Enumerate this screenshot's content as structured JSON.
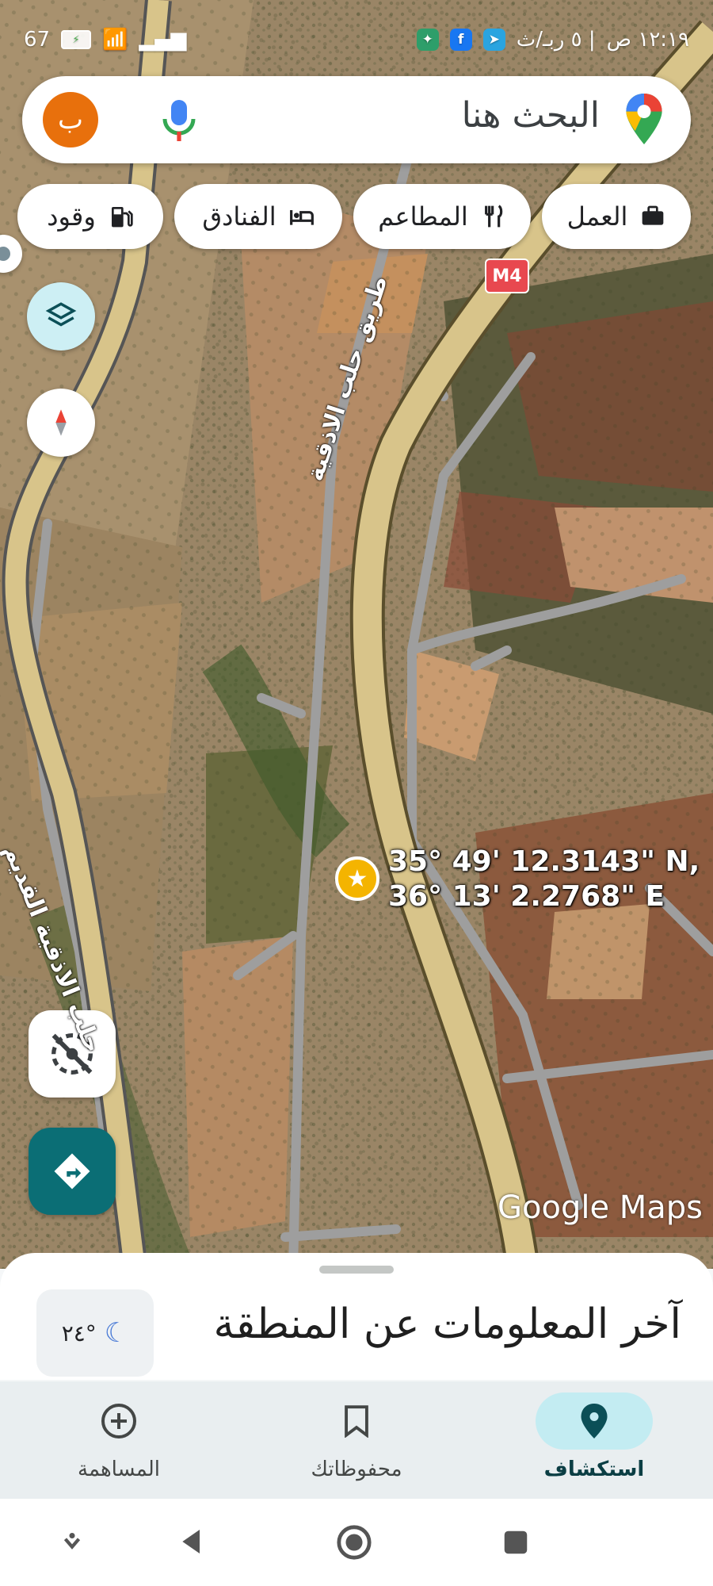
{
  "status_bar": {
    "battery_level": "67",
    "time": "١٢:١٩ ص",
    "date": "| ٥ ربـ/ث"
  },
  "search": {
    "placeholder": "البحث هنا",
    "avatar_letter": "ب"
  },
  "chips": [
    {
      "label": "العمل",
      "icon": "briefcase-icon"
    },
    {
      "label": "المطاعم",
      "icon": "restaurant-icon"
    },
    {
      "label": "الفنادق",
      "icon": "hotel-icon"
    },
    {
      "label": "وقود",
      "icon": "gas-station-icon"
    }
  ],
  "map": {
    "coordinates_lat": "35° 49' 12.3143\" N,",
    "coordinates_lon": "36° 13' 2.2768\" E",
    "road_highway_label": "طريق حلب الاذقية",
    "road_old_label": "حلب الاذقية القديم",
    "highway_shield": "M4",
    "watermark": "Google Maps"
  },
  "sheet": {
    "title": "آخر المعلومات عن المنطقة",
    "temperature": "٢٤°"
  },
  "bottom_nav": [
    {
      "label": "استكشاف",
      "icon": "explore-pin-icon",
      "active": true
    },
    {
      "label": "محفوظاتك",
      "icon": "bookmark-icon",
      "active": false
    },
    {
      "label": "المساهمة",
      "icon": "add-circle-icon",
      "active": false
    }
  ],
  "colors": {
    "accent": "#0b6e75",
    "avatar": "#e8700c",
    "nav_active_bg": "#c3ecf2",
    "highway": "#d8c48a",
    "road": "#9e9e9e"
  }
}
